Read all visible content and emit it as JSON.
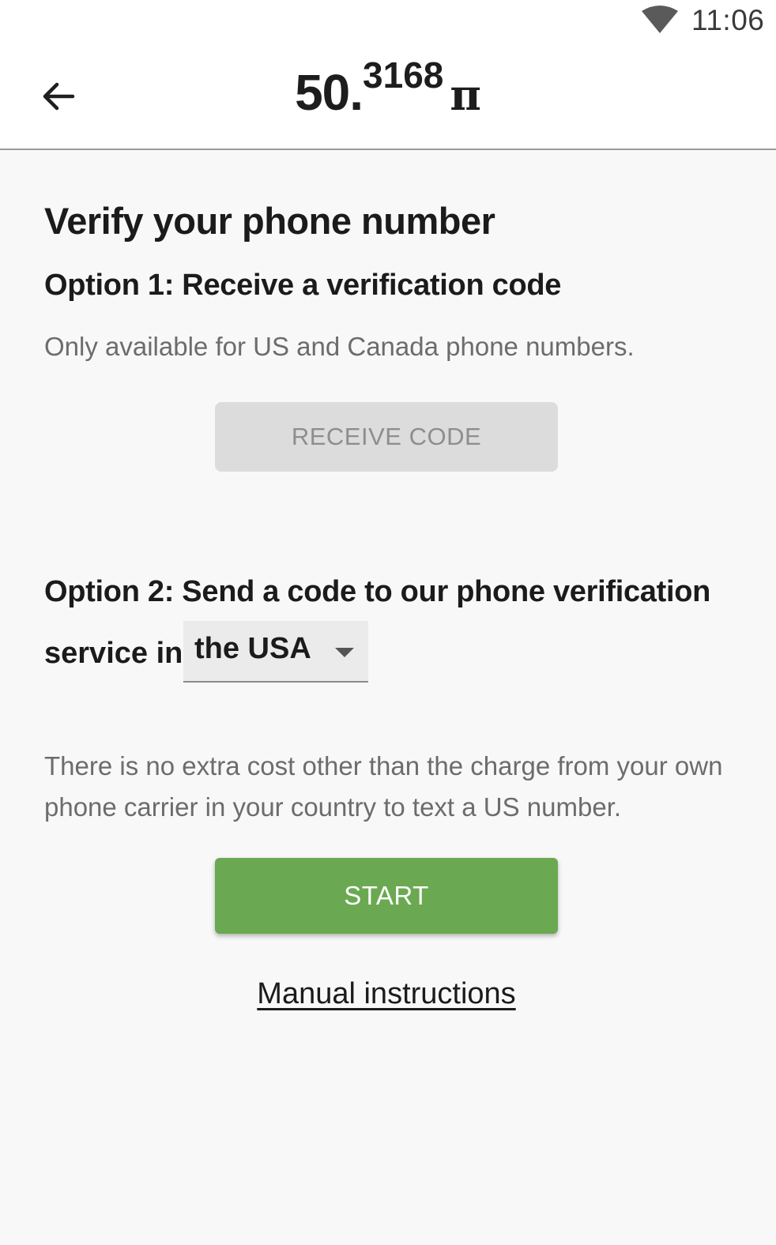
{
  "status_bar": {
    "time": "11:06",
    "wifi_icon": "wifi-icon"
  },
  "app_bar": {
    "back_icon": "arrow-left-icon",
    "balance_integer": "50.",
    "balance_decimal": "3168",
    "currency_symbol": "π"
  },
  "main": {
    "title": "Verify your phone number",
    "option1": {
      "heading": "Option 1: Receive a verification code",
      "description": "Only available for US and Canada phone numbers.",
      "button_label": "RECEIVE CODE"
    },
    "option2": {
      "heading_line1": "Option 2: Send a code to our phone verification",
      "heading_line2": "service in",
      "selected_country": "the USA",
      "note": "There is no extra cost other than the charge from your own phone carrier in your country to text a US number.",
      "button_label": "START"
    },
    "manual_link": "Manual instructions"
  },
  "colors": {
    "accent_green": "#6aa951",
    "disabled_button": "#dcdcdc",
    "background": "#f8f8f8"
  }
}
